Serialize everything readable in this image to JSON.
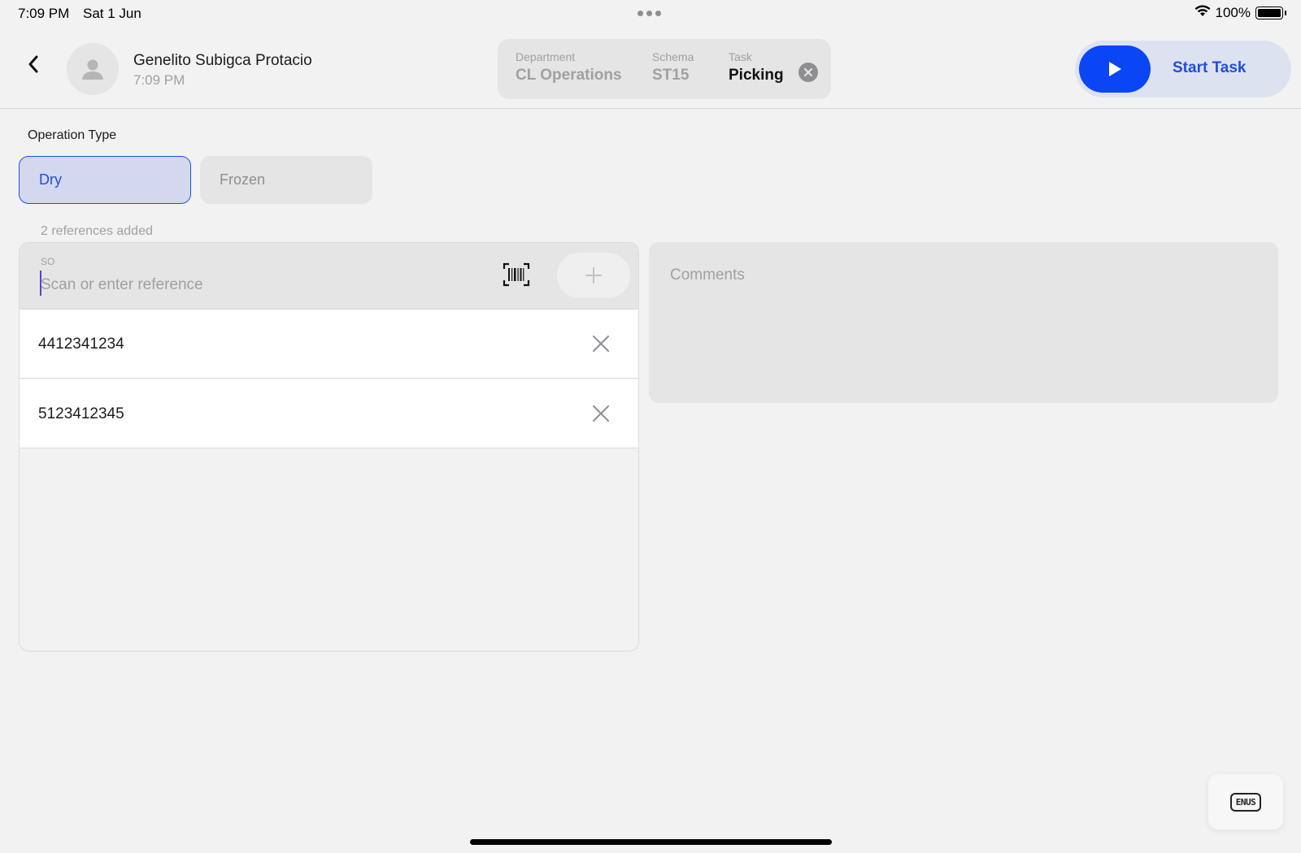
{
  "status_bar": {
    "time": "7:09 PM",
    "date": "Sat 1 Jun",
    "battery": "100%"
  },
  "header": {
    "user_name": "Genelito Subigca Protacio",
    "user_time": "7:09 PM",
    "task_chip": {
      "department_label": "Department",
      "department_value": "CL Operations",
      "schema_label": "Schema",
      "schema_value": "ST15",
      "task_label": "Task",
      "task_value": "Picking"
    },
    "start_task_label": "Start Task"
  },
  "operation_type": {
    "label": "Operation Type",
    "options": [
      {
        "label": "Dry",
        "selected": true
      },
      {
        "label": "Frozen",
        "selected": false
      }
    ]
  },
  "references": {
    "count_text": "2 references added",
    "field_label": "SO",
    "placeholder": "Scan or enter reference",
    "items": [
      {
        "value": "4412341234"
      },
      {
        "value": "5123412345"
      }
    ]
  },
  "comments": {
    "placeholder": "Comments"
  },
  "language_button": {
    "label": "ENUS"
  },
  "colors": {
    "accent": "#0a46f5",
    "accent_text": "#1f4fe0",
    "selected_bg": "#d3d8ee"
  }
}
